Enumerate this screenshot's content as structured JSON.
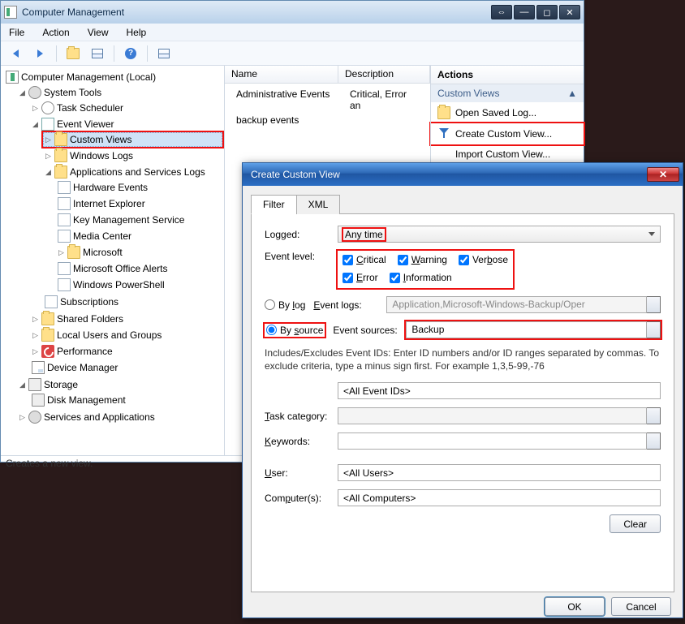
{
  "main_window": {
    "title": "Computer Management",
    "menu": [
      "File",
      "Action",
      "View",
      "Help"
    ],
    "statusbar": "Creates a new view."
  },
  "tree": {
    "root": "Computer Management (Local)",
    "system_tools": "System Tools",
    "task_scheduler": "Task Scheduler",
    "event_viewer": "Event Viewer",
    "custom_views": "Custom Views",
    "windows_logs": "Windows Logs",
    "apps_logs": "Applications and Services Logs",
    "hardware_events": "Hardware Events",
    "internet_explorer": "Internet Explorer",
    "key_mgmt": "Key Management Service",
    "media_center": "Media Center",
    "microsoft": "Microsoft",
    "office_alerts": "Microsoft Office Alerts",
    "powershell": "Windows PowerShell",
    "subscriptions": "Subscriptions",
    "shared_folders": "Shared Folders",
    "local_users": "Local Users and Groups",
    "performance": "Performance",
    "device_manager": "Device Manager",
    "storage": "Storage",
    "disk_management": "Disk Management",
    "services_apps": "Services and Applications"
  },
  "list": {
    "col_name": "Name",
    "col_desc": "Description",
    "row1_name": "Administrative Events",
    "row1_desc": "Critical, Error an",
    "row2_name": "backup events"
  },
  "actions": {
    "header": "Actions",
    "subheader": "Custom Views",
    "open_saved": "Open Saved Log...",
    "create_view": "Create Custom View...",
    "import_view": "Import Custom View..."
  },
  "dialog": {
    "title": "Create Custom View",
    "tab_filter": "Filter",
    "tab_xml": "XML",
    "logged_label": "Logged:",
    "logged_value": "Any time",
    "level_label": "Event level:",
    "lv_critical": "Critical",
    "lv_warning": "Warning",
    "lv_verbose": "Verbose",
    "lv_error": "Error",
    "lv_information": "Information",
    "by_log": "By log",
    "by_source": "By source",
    "event_logs_label": "Event logs:",
    "event_logs_value": "Application,Microsoft-Windows-Backup/Oper",
    "event_sources_label": "Event sources:",
    "event_sources_value": "Backup",
    "hint": "Includes/Excludes Event IDs: Enter ID numbers and/or ID ranges separated by commas. To exclude criteria, type a minus sign first. For example 1,3,5-99,-76",
    "all_event_ids": "<All Event IDs>",
    "task_category": "Task category:",
    "keywords": "Keywords:",
    "user_label": "User:",
    "user_value": "<All Users>",
    "computers_label": "Computer(s):",
    "computers_value": "<All Computers>",
    "clear": "Clear",
    "ok": "OK",
    "cancel": "Cancel"
  }
}
